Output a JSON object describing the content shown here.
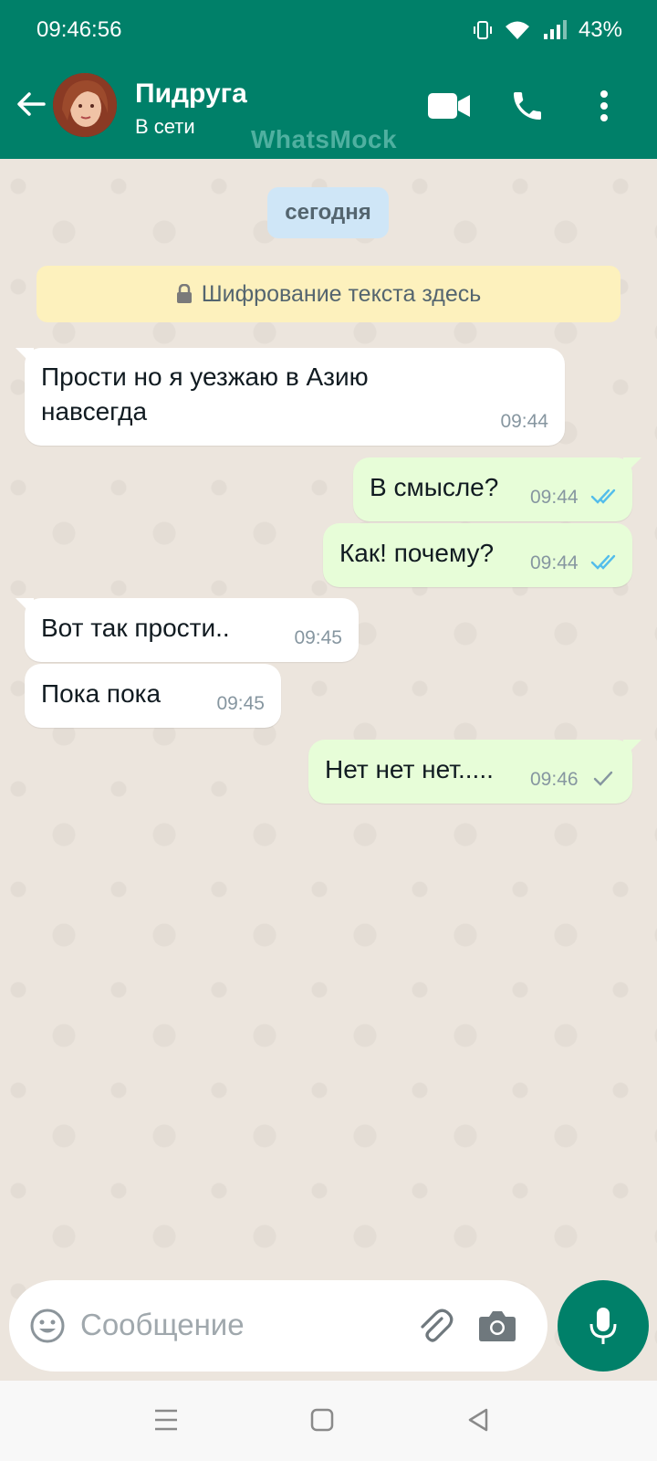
{
  "status_bar": {
    "time": "09:46:56",
    "battery": "43%"
  },
  "header": {
    "contact_name": "Пидруга",
    "contact_status": "В сети",
    "watermark": "WhatsMock",
    "icons": [
      "back-arrow-icon",
      "video-call-icon",
      "voice-call-icon",
      "more-options-icon"
    ]
  },
  "chat": {
    "date_chip": "сегодня",
    "encryption_note": "Шифрование текста здесь",
    "messages": [
      {
        "direction": "in",
        "line1": "Прости но я уезжаю в Азию",
        "line2": "навсегда",
        "time": "09:44"
      },
      {
        "direction": "out",
        "text": "В смысле?",
        "time": "09:44",
        "status": "read"
      },
      {
        "direction": "out",
        "text": "Как! почему?",
        "time": "09:44",
        "status": "read"
      },
      {
        "direction": "in",
        "text": "Вот так прости..",
        "time": "09:45"
      },
      {
        "direction": "in",
        "text": "Пока пока",
        "time": "09:45"
      },
      {
        "direction": "out",
        "text": "Нет нет нет.....",
        "time": "09:46",
        "status": "sent"
      }
    ]
  },
  "composer": {
    "placeholder": "Сообщение"
  },
  "colors": {
    "header_bg": "#008069",
    "incoming_bubble": "#ffffff",
    "outgoing_bubble": "#e7fdd8",
    "read_tick": "#53bdeb",
    "chat_bg": "#ece5dd"
  }
}
